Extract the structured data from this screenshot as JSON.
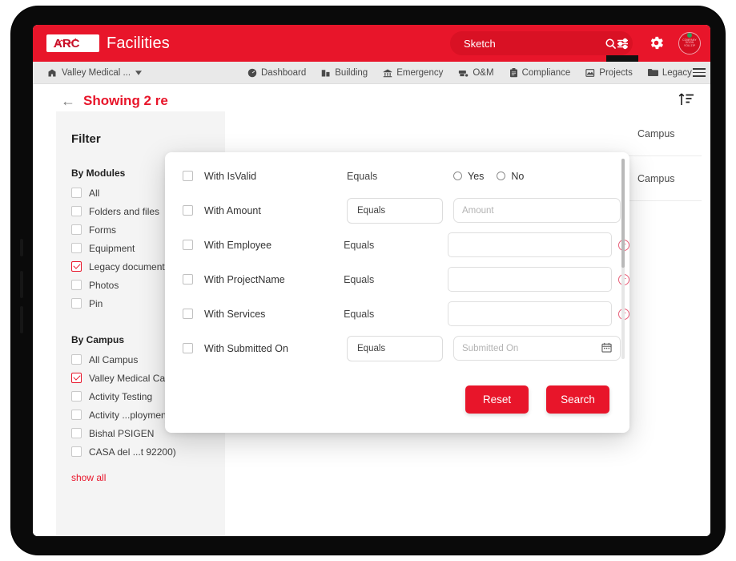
{
  "header": {
    "brand_mark": "ARC",
    "brand_word": "Facilities",
    "search_value": "Sketch",
    "search_placeholder": "Search",
    "search_icon": "search-icon",
    "filter_icon": "filter-sliders-icon",
    "settings_icon": "gear-icon",
    "badge_lines": [
      "COMPANY",
      "SOON",
      "YOU ZIP"
    ],
    "accent_color": "#e8152a"
  },
  "nav": {
    "campus_selector": "Valley Medical ...",
    "campus_icon": "building-icon",
    "chevron_icon": "chevron-down-icon",
    "links": [
      {
        "label": "Dashboard",
        "icon": "dashboard-icon"
      },
      {
        "label": "Building",
        "icon": "building-blocks-icon"
      },
      {
        "label": "Emergency",
        "icon": "emergency-bank-icon"
      },
      {
        "label": "O&M",
        "icon": "om-printer-icon"
      },
      {
        "label": "Compliance",
        "icon": "clipboard-icon"
      },
      {
        "label": "Projects",
        "icon": "projects-image-icon"
      },
      {
        "label": "Legacy",
        "icon": "folder-icon"
      }
    ],
    "menu_icon": "hamburger-menu-icon"
  },
  "results": {
    "back_icon": "back-arrow-icon",
    "title": "Showing 2 re",
    "sort_icon": "sort-ascending-icon",
    "rows": [
      {
        "text": "Campus"
      },
      {
        "text": "Campus"
      }
    ]
  },
  "sidebar": {
    "title": "Filter",
    "groups": [
      {
        "title": "By Modules",
        "items": [
          {
            "label": "All",
            "checked": false
          },
          {
            "label": "Folders and files",
            "checked": false
          },
          {
            "label": "Forms",
            "checked": false
          },
          {
            "label": "Equipment",
            "checked": false
          },
          {
            "label": "Legacy document",
            "checked": true
          },
          {
            "label": "Photos",
            "checked": false
          },
          {
            "label": "Pin",
            "checked": false
          }
        ]
      },
      {
        "title": "By Campus",
        "items": [
          {
            "label": "All Campus",
            "checked": false
          },
          {
            "label": "Valley Medical Campus",
            "checked": true
          },
          {
            "label": "Activity Testing",
            "checked": false
          },
          {
            "label": "Activity ...ployment",
            "checked": false
          },
          {
            "label": "Bishal PSIGEN",
            "checked": false
          },
          {
            "label": "CASA del ...t 92200)",
            "checked": false
          }
        ]
      }
    ],
    "show_all": "show all"
  },
  "modal": {
    "rows": [
      {
        "label": "With IsValid",
        "operator": "Equals",
        "operator_style": "plain",
        "value_type": "radio",
        "radios": [
          {
            "label": "Yes"
          },
          {
            "label": "No"
          }
        ]
      },
      {
        "label": "With Amount",
        "operator": "Equals",
        "operator_style": "box",
        "value_type": "input",
        "placeholder": "Amount",
        "has_plus": false
      },
      {
        "label": "With Employee",
        "operator": "Equals",
        "operator_style": "plain",
        "value_type": "input",
        "placeholder": "",
        "has_plus": true
      },
      {
        "label": "With ProjectName",
        "operator": "Equals",
        "operator_style": "plain",
        "value_type": "input",
        "placeholder": "",
        "has_plus": true
      },
      {
        "label": "With Services",
        "operator": "Equals",
        "operator_style": "plain",
        "value_type": "input",
        "placeholder": "",
        "has_plus": true
      },
      {
        "label": "With Submitted On",
        "operator": "Equals",
        "operator_style": "box",
        "value_type": "date",
        "placeholder": "Submitted On",
        "calendar_icon": "calendar-icon",
        "has_plus": false
      }
    ],
    "reset_label": "Reset",
    "search_label": "Search",
    "scrollbar": "modal-scrollbar"
  }
}
